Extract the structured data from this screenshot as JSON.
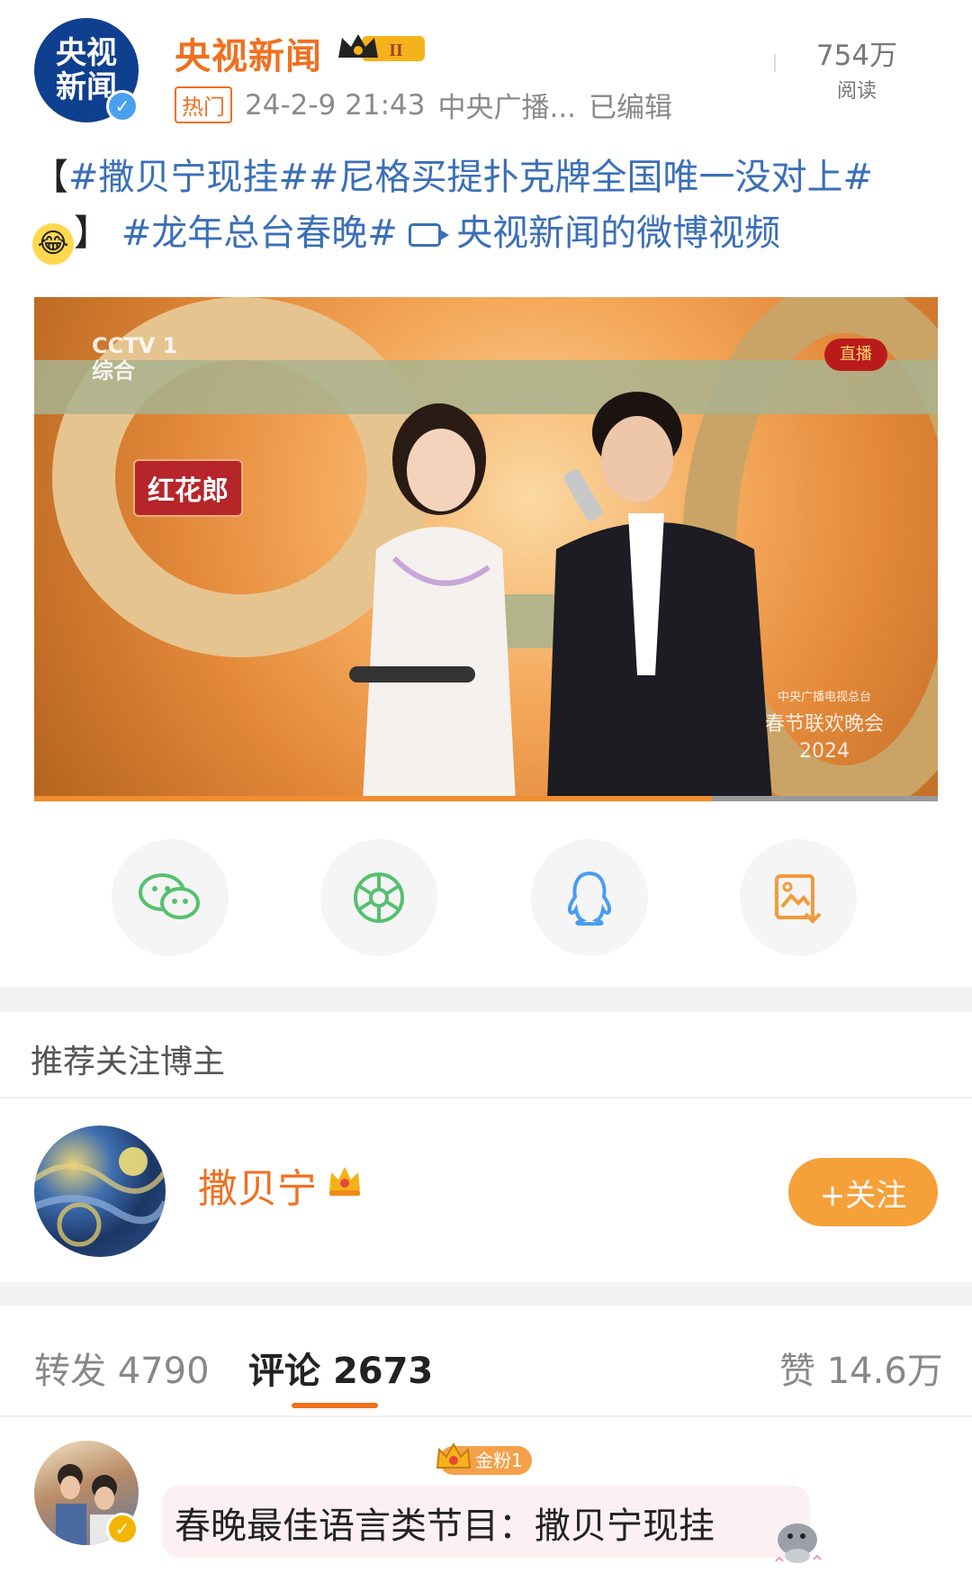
{
  "post": {
    "author": "央视新闻",
    "avatar_text_line1": "央视",
    "avatar_text_line2": "新闻",
    "level_badge": "II",
    "hot_tag": "热门",
    "timestamp": "24-2-9 21:43",
    "source": "中央广播...",
    "edited": "已编辑",
    "read_count": "754万",
    "read_label": "阅读",
    "text": {
      "open_bracket": "【",
      "topic1": "#撒贝宁现挂#",
      "topic2": "#尼格买提扑克牌全国唯一没对上#",
      "close_bracket": "】",
      "topic3": "#龙年总台春晚#",
      "video_link": "央视新闻的微博视频"
    },
    "video": {
      "channel": "CCTV 1",
      "channel_sub": "综合",
      "live_badge": "直播",
      "show_label": "红花郎",
      "gala_logo_line1": "中央广播电视总台",
      "gala_logo_line2": "春节联欢晚会",
      "gala_logo_line3": "2024",
      "progress": 0.75
    }
  },
  "share": {
    "items": [
      {
        "name": "wechat-icon",
        "color": "#56c06f"
      },
      {
        "name": "moments-icon",
        "color": "#56c06f"
      },
      {
        "name": "qq-icon",
        "color": "#4a9cf0"
      },
      {
        "name": "save-image-icon",
        "color": "#f29a3a"
      }
    ]
  },
  "recommend": {
    "title": "推荐关注博主",
    "user_name": "撒贝宁",
    "follow_label": "+关注"
  },
  "tabs": {
    "repost_label": "转发",
    "repost_count": "4790",
    "comment_label": "评论",
    "comment_count": "2673",
    "like_label": "赞",
    "like_count": "14.6万"
  },
  "comment": {
    "fan_badge": "金粉1",
    "text": "春晚最佳语言类节目：撒贝宁现挂"
  },
  "colors": {
    "accent": "#f07020",
    "topic": "#3b6fb8",
    "follow": "#f6a03a"
  }
}
